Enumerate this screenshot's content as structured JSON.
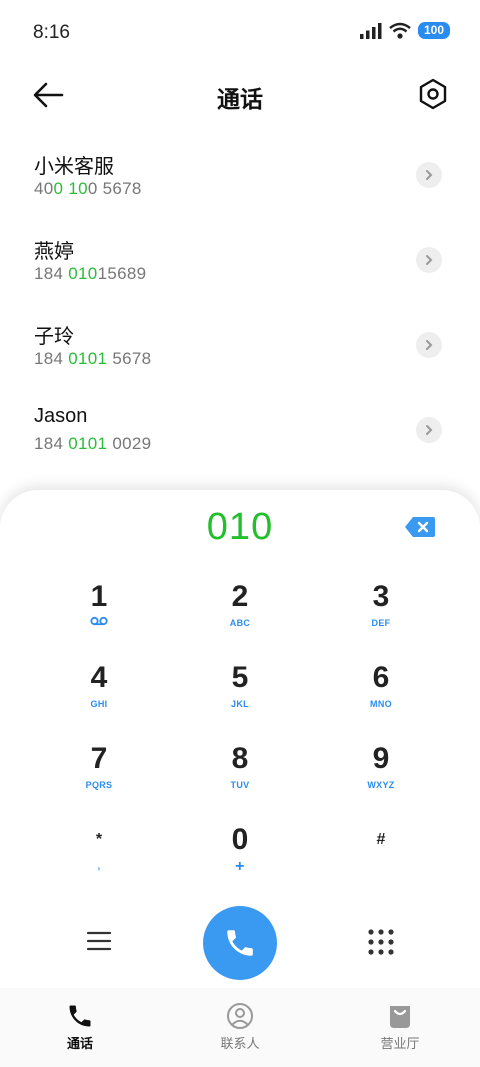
{
  "status_bar": {
    "time": "8:16",
    "battery": "100"
  },
  "header": {
    "title": "通话"
  },
  "contacts": [
    {
      "name": "小米客服",
      "number_parts": [
        "40",
        "0",
        " ",
        "10",
        "0 5678"
      ]
    },
    {
      "name": "燕婷",
      "number_parts": [
        "184 ",
        "010",
        "15689"
      ]
    },
    {
      "name": "子玲",
      "number_parts": [
        "184 ",
        "0101",
        " 5678"
      ]
    },
    {
      "name": "Jason",
      "number_parts": [
        "184 ",
        "0101",
        " 0029"
      ]
    }
  ],
  "dialer": {
    "input": "010",
    "keys": [
      {
        "digit": "1",
        "sub": ""
      },
      {
        "digit": "2",
        "sub": "ABC"
      },
      {
        "digit": "3",
        "sub": "DEF"
      },
      {
        "digit": "4",
        "sub": "GHI"
      },
      {
        "digit": "5",
        "sub": "JKL"
      },
      {
        "digit": "6",
        "sub": "MNO"
      },
      {
        "digit": "7",
        "sub": "PQRS"
      },
      {
        "digit": "8",
        "sub": "TUV"
      },
      {
        "digit": "9",
        "sub": "WXYZ"
      },
      {
        "digit": "*",
        "sub": ","
      },
      {
        "digit": "0",
        "sub": "+"
      },
      {
        "digit": "#",
        "sub": ""
      }
    ]
  },
  "bottom_nav": {
    "items": [
      {
        "label": "通话",
        "icon": "phone-icon",
        "active": true
      },
      {
        "label": "联系人",
        "icon": "contacts-icon",
        "active": false
      },
      {
        "label": "营业厅",
        "icon": "shopping-bag-icon",
        "active": false
      }
    ]
  },
  "colors": {
    "accent_blue": "#3a9af2",
    "match_green": "#22bf2c"
  }
}
